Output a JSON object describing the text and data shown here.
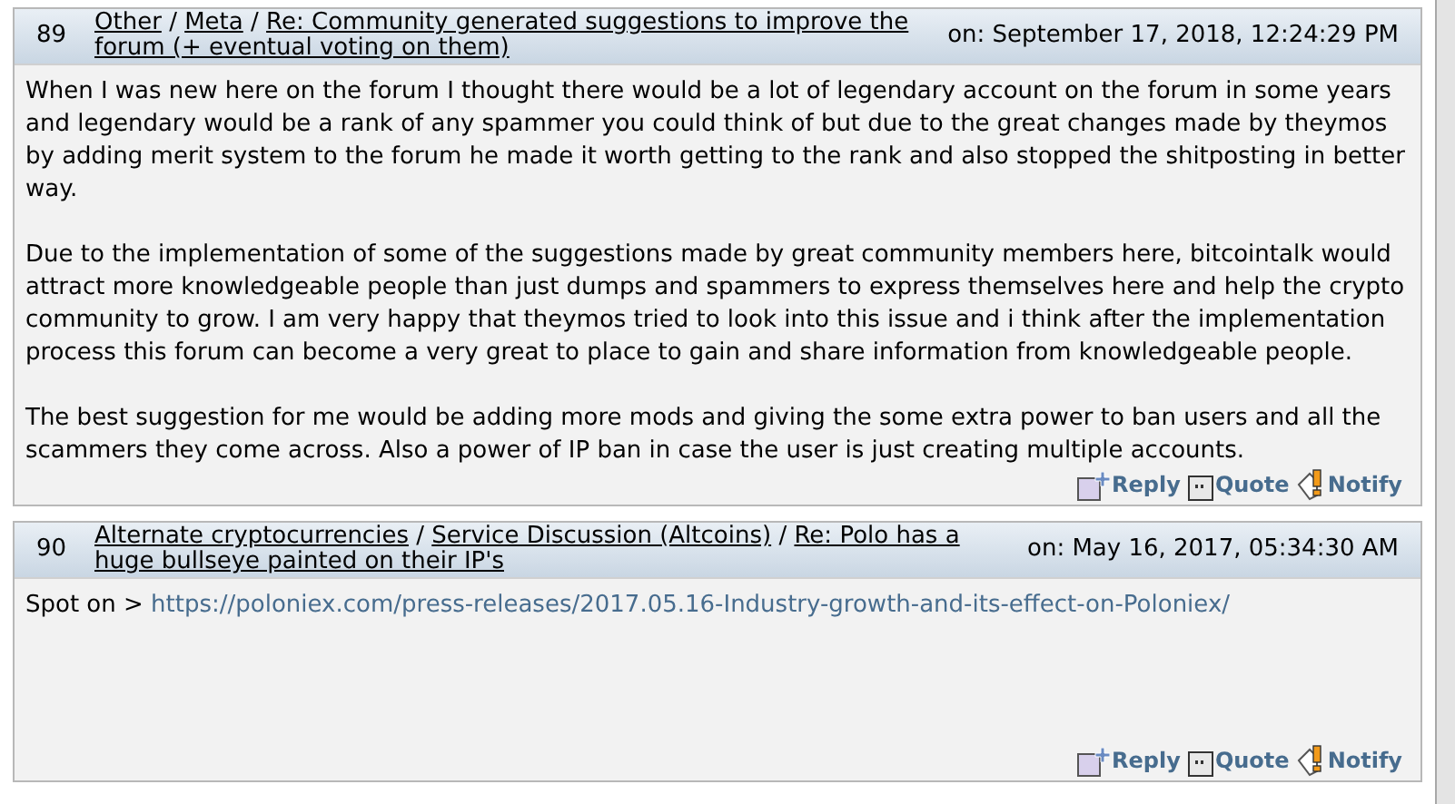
{
  "posts": [
    {
      "number": "89",
      "separator": "/",
      "breadcrumbs": [
        "Other",
        "Meta",
        "Re: Community generated suggestions to improve the forum (+ eventual voting on them)"
      ],
      "date": "on: September 17, 2018, 12:24:29 PM",
      "paragraphs": [
        {
          "text": "When I was new here on the forum I thought there would be a lot of legendary account on the forum in some years and legendary would be a rank of any spammer you could think of but due to the great changes made by theymos by adding merit system to the forum he made it worth getting to the rank and also stopped the shitposting in better way."
        },
        {
          "text": "Due to the implementation of some of the suggestions made by great community members here, bitcointalk would attract more knowledgeable people than just dumps and spammers to express themselves here and help the crypto community to grow. I am very happy that theymos tried to look into this issue and i think after the implementation process this forum can become a very great to place to gain and share information from knowledgeable people."
        },
        {
          "text": "The best suggestion for me would be adding more mods and giving the  some extra power to ban users and all the scammers they come across. Also a power of IP ban in case the user is just creating multiple accounts."
        }
      ],
      "actions": [
        {
          "kind": "reply",
          "label": "Reply"
        },
        {
          "kind": "quote",
          "label": "Quote"
        },
        {
          "kind": "notify",
          "label": "Notify"
        }
      ]
    },
    {
      "number": "90",
      "separator": "/",
      "breadcrumbs": [
        "Alternate cryptocurrencies",
        "Service Discussion (Altcoins)",
        "Re: Polo has a huge bullseye painted on their IP's"
      ],
      "date": "on: May 16, 2017, 05:34:30 AM",
      "paragraphs": [
        {
          "text": "Spot on > ",
          "link": "https://poloniex.com/press-releases/2017.05.16-Industry-growth-and-its-effect-on-Poloniex/"
        }
      ],
      "actions": [
        {
          "kind": "reply",
          "label": "Reply"
        },
        {
          "kind": "quote",
          "label": "Quote"
        },
        {
          "kind": "notify",
          "label": "Notify"
        }
      ]
    }
  ]
}
